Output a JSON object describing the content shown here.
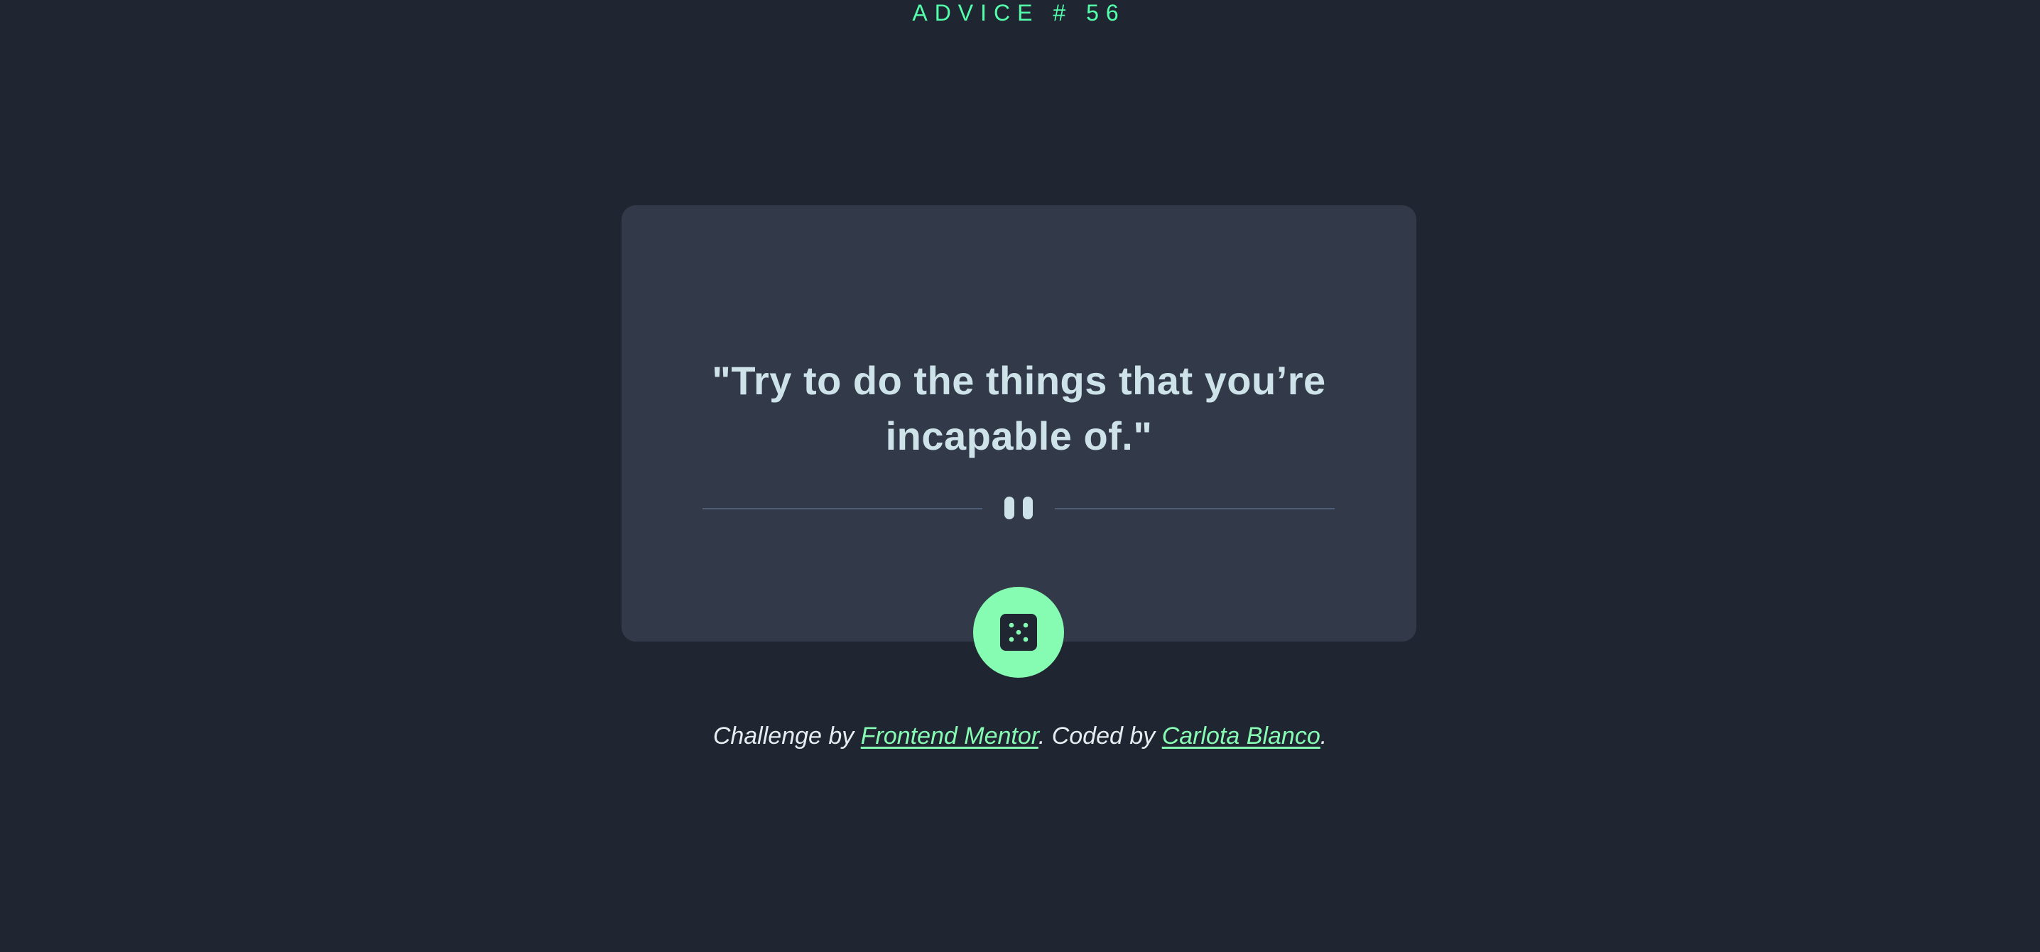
{
  "card": {
    "advice_label": "ADVICE # 56",
    "quote": "\"Try to do the things that you’re incapable of.\""
  },
  "divider": {
    "icon": "pause-icon"
  },
  "button": {
    "icon": "dice-icon",
    "aria_label": "Generate new advice"
  },
  "footer": {
    "text_1": "Challenge by ",
    "link_1": "Frontend Mentor",
    "text_2": ". Coded by ",
    "link_2": "Carlota Blanco",
    "text_3": "."
  },
  "colors": {
    "background": "#1f2632",
    "card": "#323a49",
    "accent": "#86fbb2",
    "quote_text": "#cee3e9",
    "divider": "#4f5d74"
  }
}
